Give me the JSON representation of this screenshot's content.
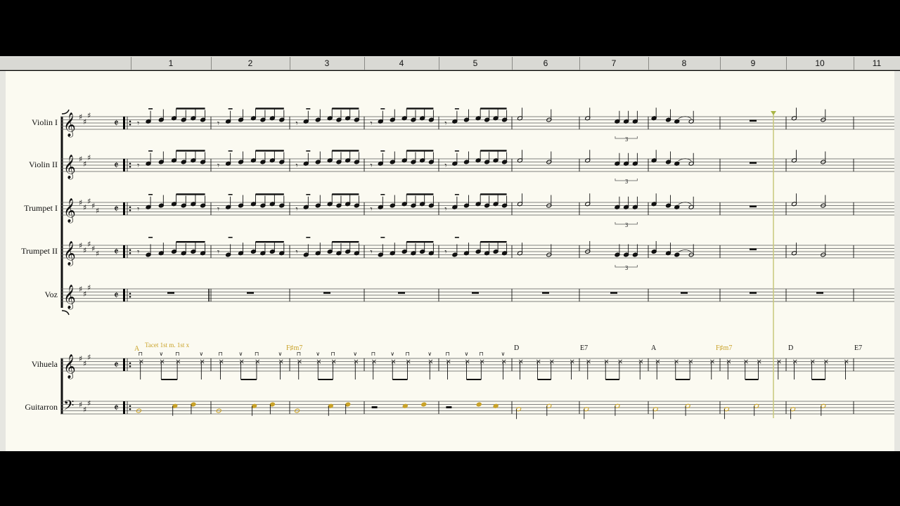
{
  "ruler": {
    "measures": [
      "1",
      "2",
      "3",
      "4",
      "5",
      "6",
      "7",
      "8",
      "9",
      "10",
      "11"
    ]
  },
  "instruments": [
    {
      "key": "violin1",
      "name": "Violin I"
    },
    {
      "key": "violin2",
      "name": "Violin II"
    },
    {
      "key": "trumpet1",
      "name": "Trumpet I"
    },
    {
      "key": "trumpet2",
      "name": "Trumpet II"
    },
    {
      "key": "voz",
      "name": "Voz"
    },
    {
      "key": "vihuela",
      "name": "Vihuela"
    },
    {
      "key": "guitarron",
      "name": "Guitarron"
    }
  ],
  "time_signature": "𝄵",
  "tuplet_label": "3",
  "annotations": {
    "rehearsal_a": "A",
    "tacet": "Tacet 1st m. 1st x"
  },
  "chord_symbols": [
    {
      "measure": 5,
      "label": "F♯m7"
    },
    {
      "measure": 6,
      "label": "D"
    },
    {
      "measure": 7,
      "label": "E7"
    },
    {
      "measure": 8,
      "label": "A"
    },
    {
      "measure": 9,
      "label": "F♯m7"
    },
    {
      "measure": 10,
      "label": "D"
    },
    {
      "measure": 11,
      "label": "E7"
    }
  ],
  "colors": {
    "staff_line": "#5a5a5a",
    "note": "#111111",
    "highlight": "#c9a228",
    "playback_cursor": "#c8c77a",
    "paper": "#fbfaf1"
  }
}
